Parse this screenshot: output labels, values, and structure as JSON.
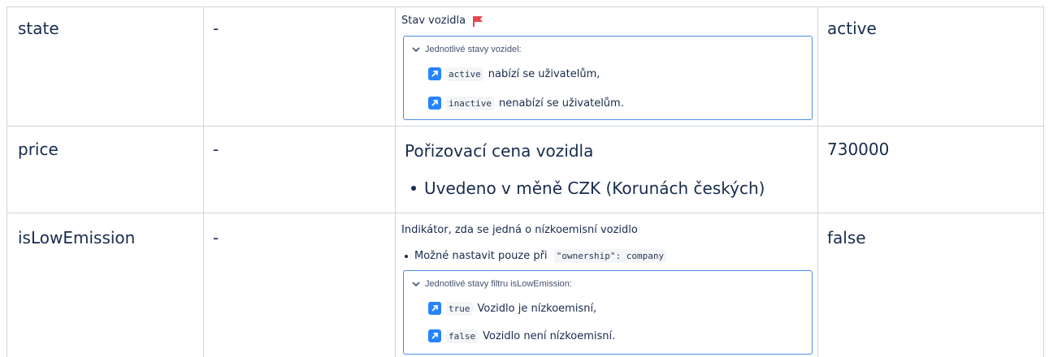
{
  "rows": [
    {
      "name": "state",
      "dash": "-",
      "description": {
        "title": "Stav vozidla",
        "expand_title": "Jednotlivé stavy vozidel:",
        "items": [
          {
            "code": "active",
            "text": "nabízí se uživatelům,"
          },
          {
            "code": "inactive",
            "text": "nenabízí se uživatelům."
          }
        ]
      },
      "example": "active"
    },
    {
      "name": "price",
      "dash": "-",
      "description": {
        "title": "Pořizovací cena vozidla",
        "bullet": "Uvedeno v měně CZK (Korunách českých)"
      },
      "example": "730000"
    },
    {
      "name": "isLowEmission",
      "dash": "-",
      "description": {
        "title": "Indikátor, zda se jedná o nízkoemisní vozidlo",
        "bullet_prefix": "Možné nastavit pouze při",
        "bullet_code": "\"ownership\": company",
        "expand_title": "Jednotlivé stavy filtru isLowEmission:",
        "items": [
          {
            "code": "true",
            "text": "Vozidlo je nízkoemisní,"
          },
          {
            "code": "false",
            "text": "Vozidlo není nízkoemisní."
          }
        ]
      },
      "example": "false"
    }
  ],
  "icons": {
    "flag": "red-flag-icon",
    "chevron": "chevron-down-icon",
    "arrow": "arrow-up-right-icon"
  },
  "colors": {
    "accent": "#2684ff",
    "border": "#4c8be6",
    "flag": "#e5484d"
  }
}
